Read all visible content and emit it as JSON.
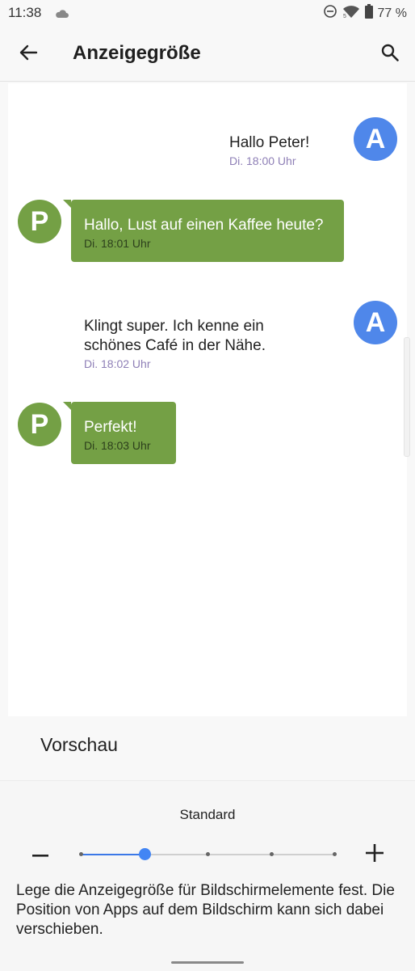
{
  "status_bar": {
    "time": "11:38",
    "battery": "77 %"
  },
  "app_bar": {
    "title": "Anzeigegröße"
  },
  "messages": [
    {
      "avatar": "A",
      "text": "Hallo Peter!",
      "time": "Di. 18:00 Uhr"
    },
    {
      "avatar": "P",
      "text": "Hallo, Lust auf einen Kaffee heute?",
      "time": "Di. 18:01 Uhr"
    },
    {
      "avatar": "A",
      "text": "Klingt super. Ich kenne ein schönes Café in der Nähe.",
      "time": "Di. 18:02 Uhr"
    },
    {
      "avatar": "P",
      "text": "Perfekt!",
      "time": "Di. 18:03 Uhr"
    }
  ],
  "preview_label": "Vorschau",
  "size_control": {
    "current_label": "Standard",
    "levels": 5,
    "selected_index": 1
  },
  "description": "Lege die Anzeigegröße für Bildschirmelemente fest. Die Position von Apps auf dem Bildschirm kann sich dabei verschieben.",
  "colors": {
    "avatar_a": "#4f87ea",
    "avatar_p": "#74a045",
    "bubble_green": "#74a045",
    "accent": "#4285f4",
    "timestamp_plain": "#8e7fb6"
  }
}
